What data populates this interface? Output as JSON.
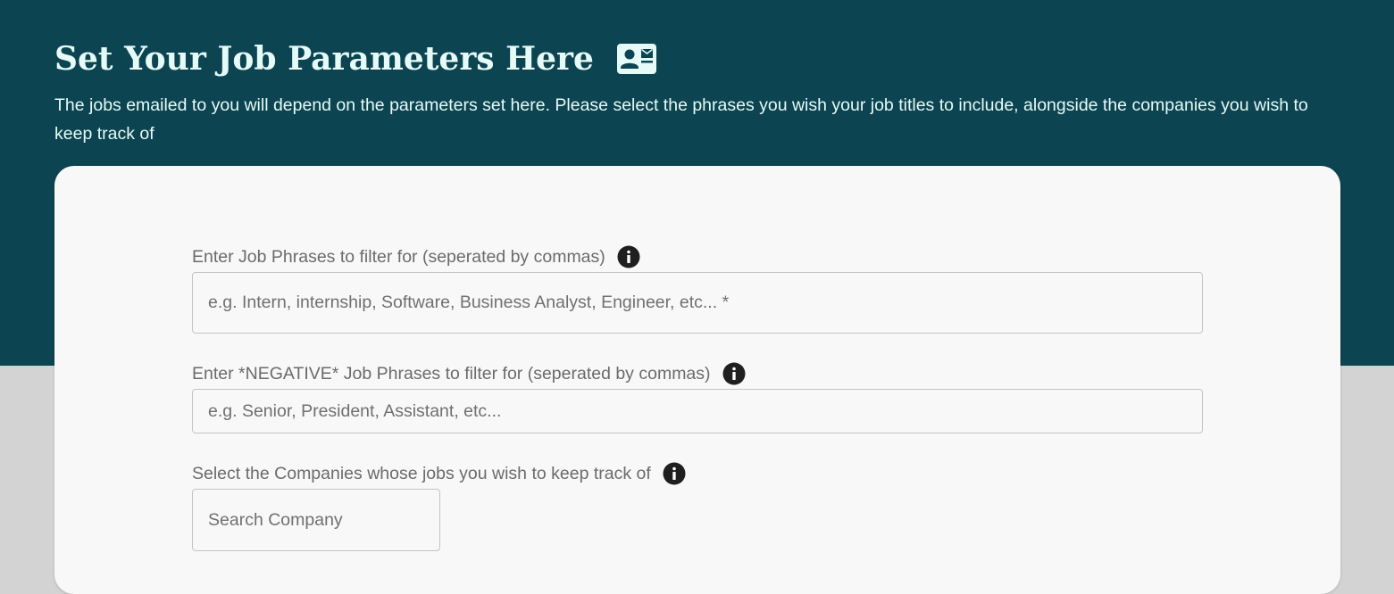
{
  "header": {
    "title": "Set Your Job Parameters Here",
    "title_icon": "contact-mail-icon",
    "subtitle": "The jobs emailed to you will depend on the parameters set here. Please select the phrases you wish your job titles to include, alongside the companies you wish to keep track of"
  },
  "form": {
    "job_phrases": {
      "label": "Enter Job Phrases to filter for (seperated by commas)",
      "placeholder": "e.g. Intern, internship, Software, Business Analyst, Engineer, etc... *",
      "info_icon": "info-icon"
    },
    "negative_phrases": {
      "label": "Enter *NEGATIVE* Job Phrases to filter for (seperated by commas)",
      "placeholder": "e.g. Senior, President, Assistant, etc...",
      "info_icon": "info-icon"
    },
    "companies": {
      "label": "Select the Companies whose jobs you wish to keep track of",
      "placeholder": "Search Company",
      "info_icon": "info-icon"
    }
  },
  "colors": {
    "header_bg": "#0c4451",
    "header_text": "#e6fbf7",
    "card_bg": "#f8f8f8",
    "page_bg": "#d3d3d3",
    "label_text": "#6b6b6b"
  }
}
